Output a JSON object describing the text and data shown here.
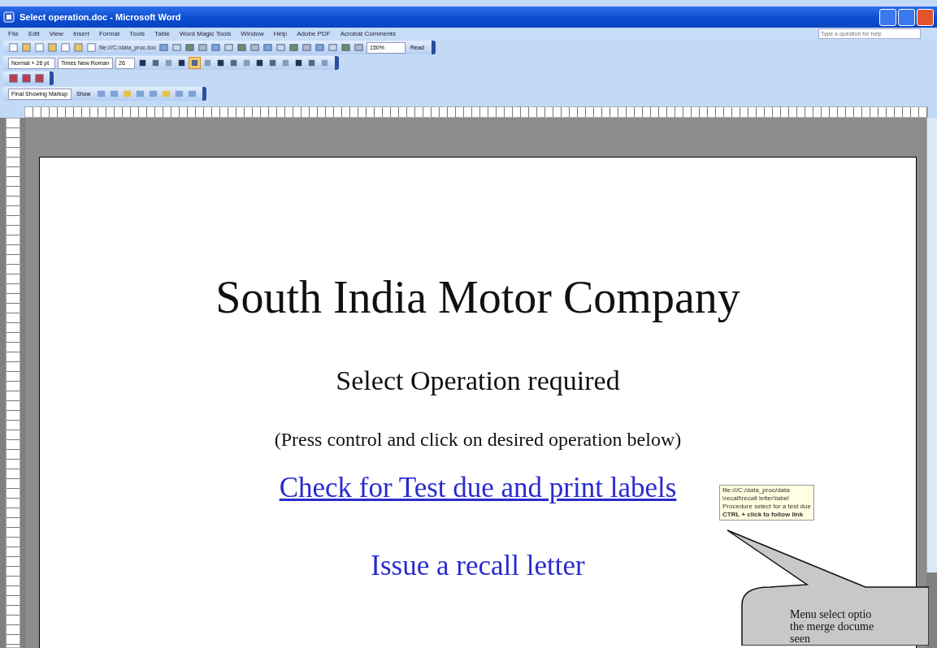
{
  "window": {
    "title": "Select operation.doc - Microsoft Word"
  },
  "menu": [
    "File",
    "Edit",
    "View",
    "Insert",
    "Format",
    "Tools",
    "Table",
    "Word Magic Tools",
    "Window",
    "Help",
    "Adobe PDF",
    "Acrobat Comments"
  ],
  "help_box": {
    "placeholder": "Type a question for help"
  },
  "standard_toolbar": {
    "path": "file:///C:/data_proc.doc",
    "zoom": "150%",
    "read": "Read"
  },
  "formatting_toolbar": {
    "style": "Normal + 26 pt",
    "font": "Times New Roman",
    "size": "26"
  },
  "reviewing_toolbar": {
    "display": "Final Showing Markup",
    "show": "Show"
  },
  "document": {
    "heading": "South India Motor Company",
    "subheading": "Select Operation required",
    "instruction": "(Press control and click on desired operation below)",
    "links": [
      "Check for Test due and print labels",
      "Issue a recall letter"
    ]
  },
  "tooltip": {
    "lines": [
      "file:///C:/data_proc/data",
      "\\recall\\recall letter\\label",
      "Procedure select for a test due",
      "CTRL + click to follow link"
    ]
  },
  "callout": {
    "lines": [
      "Menu select optio",
      "the merge docume",
      "seen"
    ]
  }
}
